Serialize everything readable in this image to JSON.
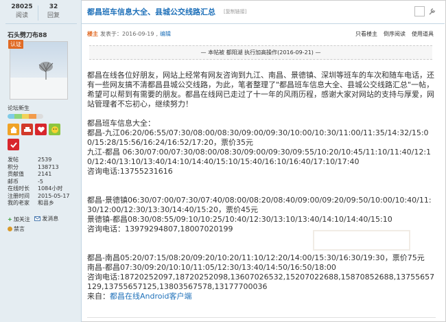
{
  "stats": {
    "views": "28025",
    "views_label": "阅读",
    "replies": "32",
    "replies_label": "回复"
  },
  "user": {
    "name": "石头劈刀布88",
    "auth_badge": "认证",
    "rank": "论坛新生",
    "info": [
      {
        "k": "发帖",
        "v": "2539"
      },
      {
        "k": "积分",
        "v": "138713"
      },
      {
        "k": "贡献值",
        "v": "2141"
      },
      {
        "k": "邮币",
        "v": "-5"
      },
      {
        "k": "在线时长",
        "v": "1084小时"
      },
      {
        "k": "注册时间",
        "v": "2015-05-17"
      },
      {
        "k": "我的老家",
        "v": "和县乡"
      }
    ],
    "follow": "加关注",
    "message": "发消息",
    "ban": "禁言"
  },
  "post": {
    "title": "都昌班车信息大全、县城公交线路汇总",
    "copy_link": "[复制链接]",
    "author_badge": "楼主",
    "posted": "发表于：2016-09-19",
    "edit": "编辑",
    "view_op": "只看楼主",
    "reverse": "倒序阅读",
    "tools": "使用道具",
    "notice": "— 本帖被 都阳湖 执行加高操作(2016-09-21) —",
    "intro": "都昌在线各位好朋友，网站上经常有网友咨询到九江、南昌、景德镇、深圳等班车的车次和随车电话，还有一些网友搞不清都昌县城公交线路，为此，笔者整理了\"都昌班车信息大全、县城公交线路汇总\"一帖，希望可以帮到有需要的朋友。都昌在线网已走过了十一年的风雨历程，感谢大家对网站的支持与厚爱，网站管理者不忘初心，继续努力！",
    "s1": "都昌班车信息大全：",
    "s2": "都昌-九江06:20/06:55/07:30/08:00/08:30/09:00/09:30/10:00/10:30/11:00/11:35/14:32/15:00/15:28/15:56/16:24/16:52/17:20，票价35元",
    "s3": "九江-都昌 06:30/07:00/07:30/08:00/08:30/09:00/09:30/09:55/10:20/10:45/11:10/11:40/12:10/12:40/13:10/13:40/14:10/14:40/15:10/15:40/16:10/16:40/17:10/17:40",
    "s4": "咨询电话:13755231616",
    "s5": "都昌-景德镇06:30/07:00/07:30/07:40/08:00/08:20/08:40/09:00/09:20/09:50/10:00/10:40/11:30/12:00/12:30/13:30/14:40/15:20，票价45元",
    "s6": "景德镇-都昌08:30/08:55/09:10/10:25/10:40/12:30/13:10/13:40/14:10/14:40/15:10",
    "s7": "咨询电话：13979294807,18007020199",
    "s8": "都昌-南昌05:20/07:15/08:20/09:20/10:20/11:10/12:20/14:00/15:30/16:30/19:30，票价75元",
    "s9": "南昌-都昌07:30/09:20/10:10/11:05/12:30/13:40/14:50/16:50/18:00",
    "s10": "咨询电话:18720252097,18720252098,13607026532,15207022688,15870852688,13755657129,13755657125,13803567578,13177700036",
    "s11": "来自：",
    "s11_link": "都昌在线Android客户端"
  },
  "colors": {
    "link": "#1e70b9",
    "sidebar": "#e5edf2",
    "badge": "#e06a24"
  }
}
